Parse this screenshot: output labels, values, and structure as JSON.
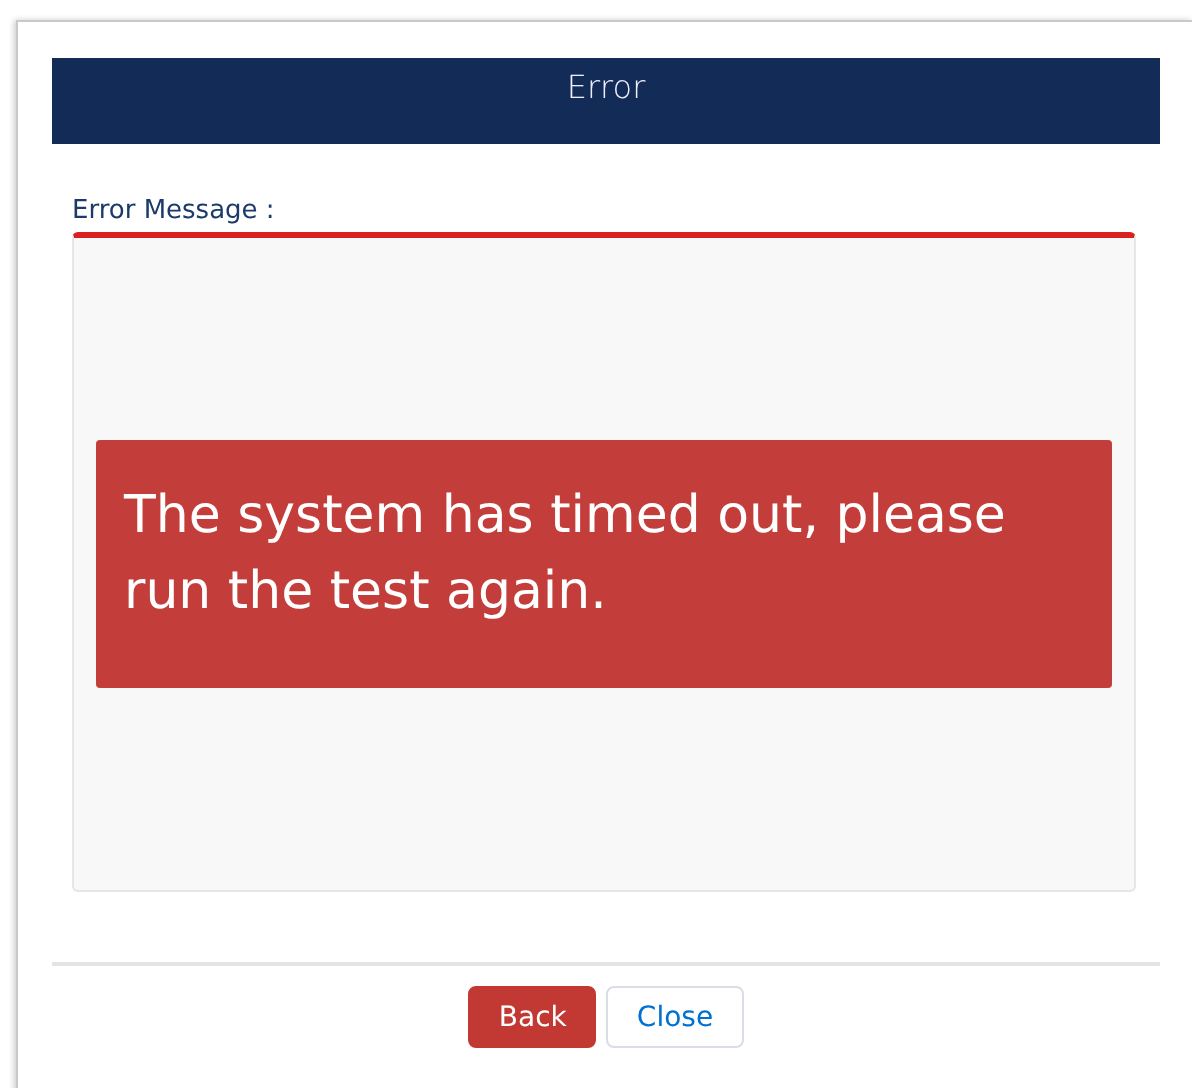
{
  "dialog": {
    "title": "Error"
  },
  "field_label": "Error Message :",
  "message": "The system has timed out, please run the test again.",
  "buttons": [
    {
      "label": "Back",
      "kind": "primary"
    },
    {
      "label": "Close",
      "kind": "neutral"
    }
  ]
}
